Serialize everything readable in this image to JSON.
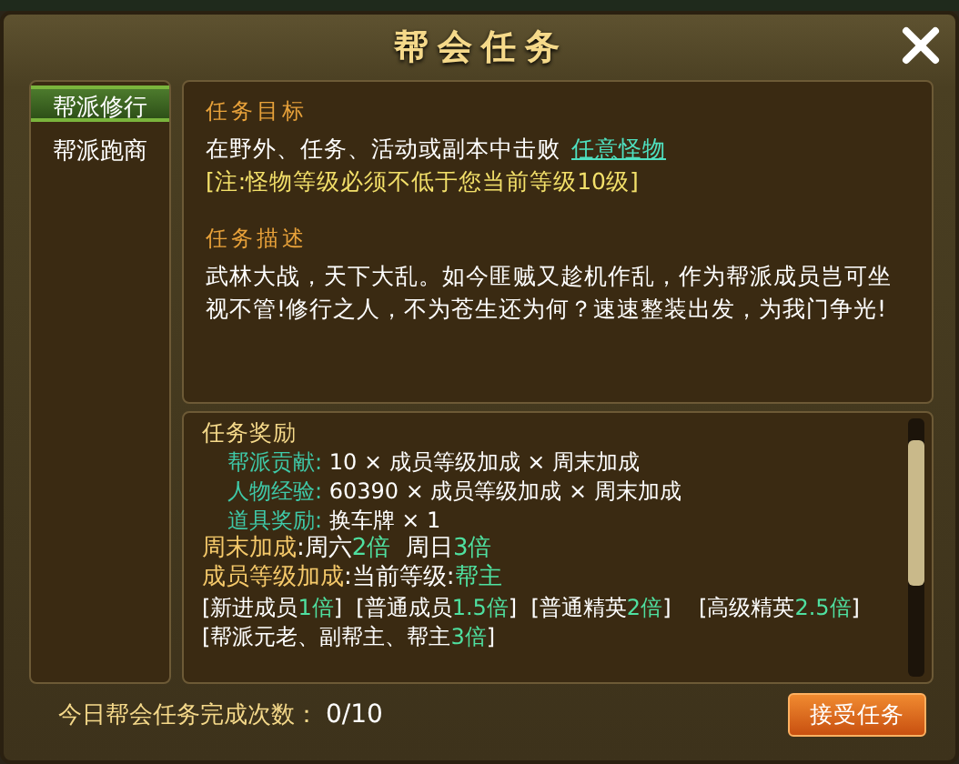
{
  "window": {
    "title": "帮会任务"
  },
  "tabs": [
    {
      "label": "帮派修行",
      "selected": true
    },
    {
      "label": "帮派跑商",
      "selected": false
    }
  ],
  "objective": {
    "heading": "任务目标",
    "text": "在野外、任务、活动或副本中击败",
    "link": "任意怪物",
    "note": "[注:怪物等级必须不低于您当前等级10级]"
  },
  "description": {
    "heading": "任务描述",
    "text": "武林大战，天下大乱。如今匪贼又趁机作乱，作为帮派成员岂可坐视不管!修行之人，不为苍生还为何？速速整装出发，为我门争光!"
  },
  "rewards": {
    "heading": "任务奖励",
    "lines": [
      {
        "kind": "item",
        "parts": [
          {
            "kind": "label",
            "text": "帮派贡献:"
          },
          {
            "kind": "plain",
            "text": " 10 × 成员等级加成 × 周末加成"
          }
        ]
      },
      {
        "kind": "item",
        "parts": [
          {
            "kind": "label",
            "text": "人物经验:"
          },
          {
            "kind": "plain",
            "text": " 60390 × 成员等级加成 × 周末加成"
          }
        ]
      },
      {
        "kind": "item",
        "parts": [
          {
            "kind": "label",
            "text": "道具奖励:"
          },
          {
            "kind": "plain",
            "text": " 换车牌 × 1"
          }
        ]
      },
      {
        "kind": "bonus",
        "parts": [
          {
            "kind": "gold",
            "text": "周末加成"
          },
          {
            "kind": "plain",
            "text": ":周六"
          },
          {
            "kind": "value",
            "text": "2倍"
          },
          {
            "kind": "plain",
            "text": "  周日"
          },
          {
            "kind": "value",
            "text": "3倍"
          }
        ]
      },
      {
        "kind": "bonus",
        "parts": [
          {
            "kind": "gold",
            "text": "成员等级加成"
          },
          {
            "kind": "plain",
            "text": ":当前等级:"
          },
          {
            "kind": "value",
            "text": "帮主"
          }
        ]
      },
      {
        "kind": "plain",
        "parts": [
          {
            "kind": "plain",
            "text": "[新进成员"
          },
          {
            "kind": "value",
            "text": "1倍"
          },
          {
            "kind": "plain",
            "text": "]  [普通成员"
          },
          {
            "kind": "value",
            "text": "1.5倍"
          },
          {
            "kind": "plain",
            "text": "]  [普通精英"
          },
          {
            "kind": "value",
            "text": "2倍"
          },
          {
            "kind": "plain",
            "text": "]    [高级精英"
          },
          {
            "kind": "value",
            "text": "2.5倍"
          },
          {
            "kind": "plain",
            "text": "]  [帮派元老、副帮主、帮主"
          },
          {
            "kind": "value",
            "text": "3倍"
          },
          {
            "kind": "plain",
            "text": "]"
          }
        ]
      }
    ]
  },
  "footer": {
    "label": "今日帮会任务完成次数：",
    "count": "0/10",
    "button": "接受任务"
  }
}
